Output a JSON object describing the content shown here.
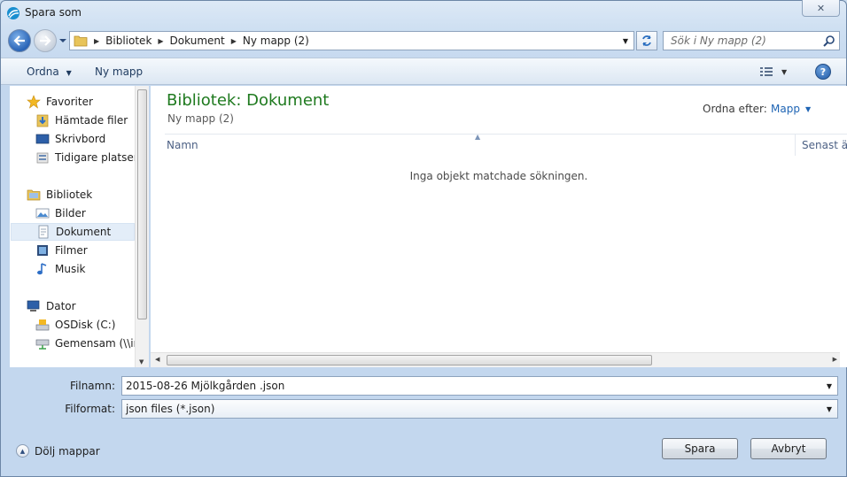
{
  "window": {
    "title": "Spara som",
    "close_label": "✕"
  },
  "address": {
    "breadcrumbs": [
      "Bibliotek",
      "Dokument",
      "Ny mapp (2)"
    ]
  },
  "search": {
    "placeholder": "Sök i Ny mapp (2)"
  },
  "toolbar": {
    "organize_label": "Ordna",
    "new_folder_label": "Ny mapp"
  },
  "nav": {
    "favorites": {
      "label": "Favoriter",
      "items": [
        "Hämtade filer",
        "Skrivbord",
        "Tidigare platser"
      ]
    },
    "libraries": {
      "label": "Bibliotek",
      "items": [
        "Bilder",
        "Dokument",
        "Filmer",
        "Musik"
      ],
      "selected": "Dokument"
    },
    "computer": {
      "label": "Dator",
      "items": [
        "OSDisk (C:)",
        "Gemensam (\\\\int"
      ]
    }
  },
  "content": {
    "title": "Bibliotek: Dokument",
    "subtitle": "Ny mapp (2)",
    "arrange_label": "Ordna efter:",
    "arrange_value": "Mapp",
    "columns": [
      "Namn",
      "Senast ändrad"
    ],
    "empty_message": "Inga objekt matchade sökningen."
  },
  "form": {
    "filename_label": "Filnamn:",
    "filename_value": "2015-08-26 Mjölkgården  .json",
    "filetype_label": "Filformat:",
    "filetype_value": "json files (*.json)"
  },
  "footer": {
    "hide_folders_label": "Dölj mappar",
    "save_label": "Spara",
    "cancel_label": "Avbryt"
  },
  "colors": {
    "title_green": "#1f7a1f",
    "link_blue": "#1e64b4",
    "frame_blue": "#c9dbee"
  }
}
